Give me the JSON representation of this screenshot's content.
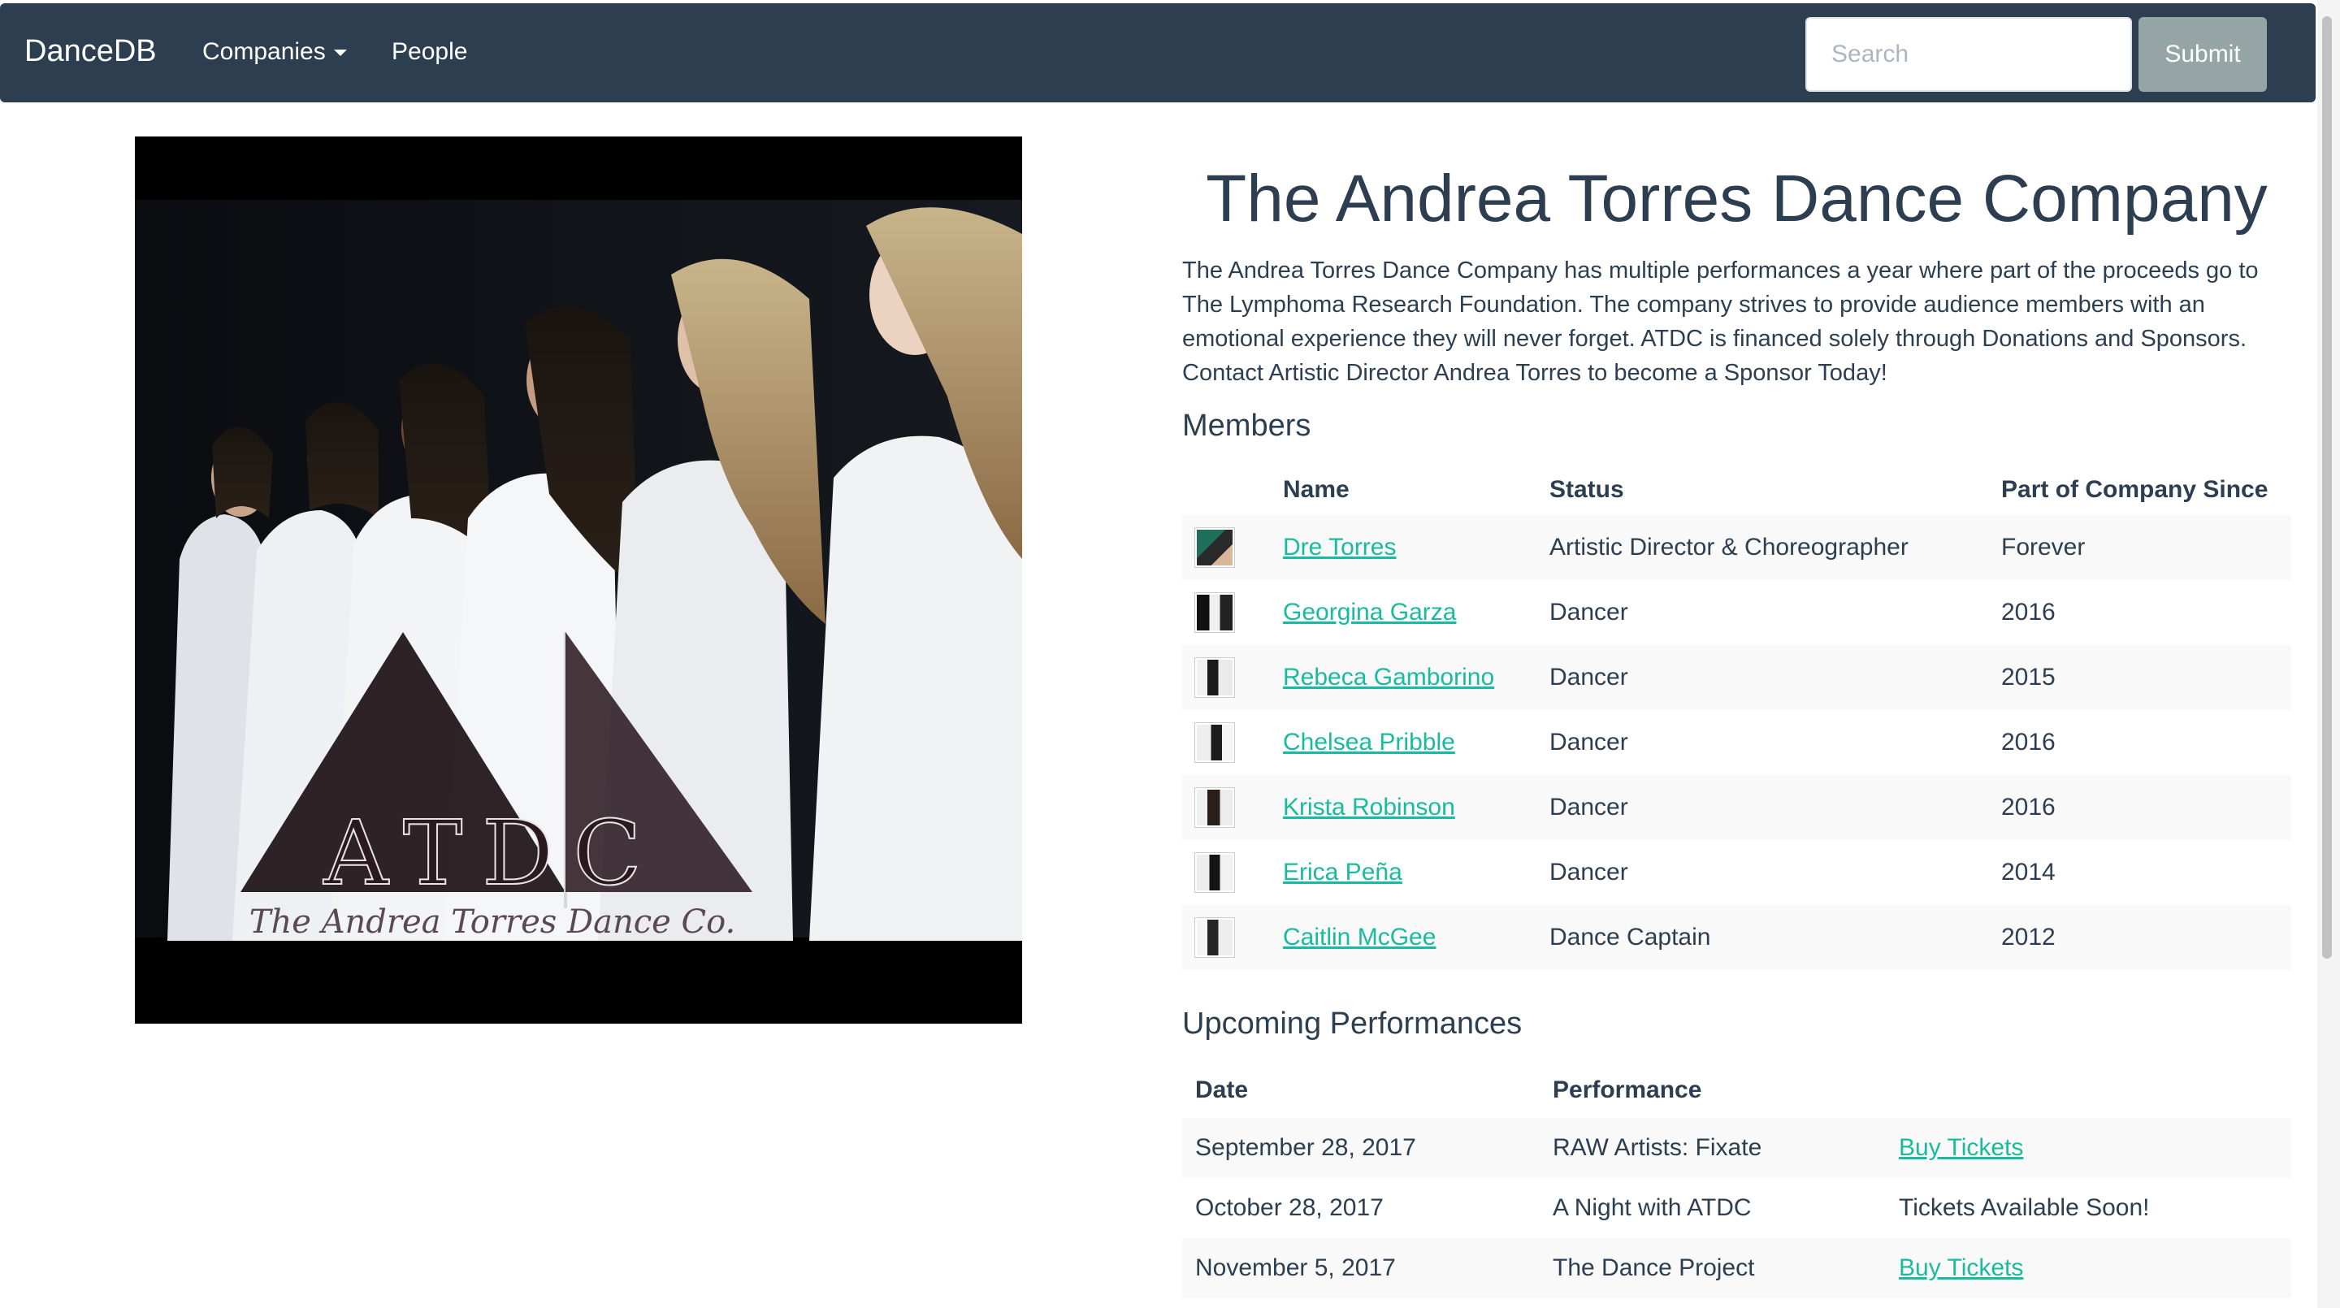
{
  "navbar": {
    "brand": "DanceDB",
    "companies_label": "Companies",
    "people_label": "People",
    "search_placeholder": "Search",
    "submit_label": "Submit"
  },
  "company": {
    "name": "The Andrea Torres Dance Company",
    "description": "The Andrea Torres Dance Company has multiple performances a year where part of the proceeds go to The Lymphoma Research Foundation. The company strives to provide audience members with an emotional experience they will never forget. ATDC is financed solely through Donations and Sponsors. Contact Artistic Director Andrea Torres to become a Sponsor Today!",
    "image_logo_text": "ATDC",
    "image_caption_text": "The Andrea Torres Dance Co."
  },
  "members": {
    "title": "Members",
    "headers": {
      "name": "Name",
      "status": "Status",
      "since": "Part of Company Since"
    },
    "rows": [
      {
        "name": "Dre Torres",
        "status": "Artistic Director & Choreographer",
        "since": "Forever"
      },
      {
        "name": "Georgina Garza",
        "status": "Dancer",
        "since": "2016"
      },
      {
        "name": "Rebeca Gamborino",
        "status": "Dancer",
        "since": "2015"
      },
      {
        "name": "Chelsea Pribble",
        "status": "Dancer",
        "since": "2016"
      },
      {
        "name": "Krista Robinson",
        "status": "Dancer",
        "since": "2016"
      },
      {
        "name": "Erica Peña",
        "status": "Dancer",
        "since": "2014"
      },
      {
        "name": "Caitlin McGee",
        "status": "Dance Captain",
        "since": "2012"
      }
    ]
  },
  "performances": {
    "title": "Upcoming Performances",
    "headers": {
      "date": "Date",
      "performance": "Performance"
    },
    "rows": [
      {
        "date": "September 28, 2017",
        "performance": "RAW Artists: Fixate",
        "tickets": "Buy Tickets"
      },
      {
        "date": "October 28, 2017",
        "performance": "A Night with ATDC",
        "tickets": "Tickets Available Soon!"
      },
      {
        "date": "November 5, 2017",
        "performance": "The Dance Project",
        "tickets": "Buy Tickets"
      }
    ]
  },
  "colors": {
    "navbar_bg": "#2c3e50",
    "link": "#18bc9c",
    "submit_bg": "#95a5a6",
    "text": "#2c3e50"
  }
}
